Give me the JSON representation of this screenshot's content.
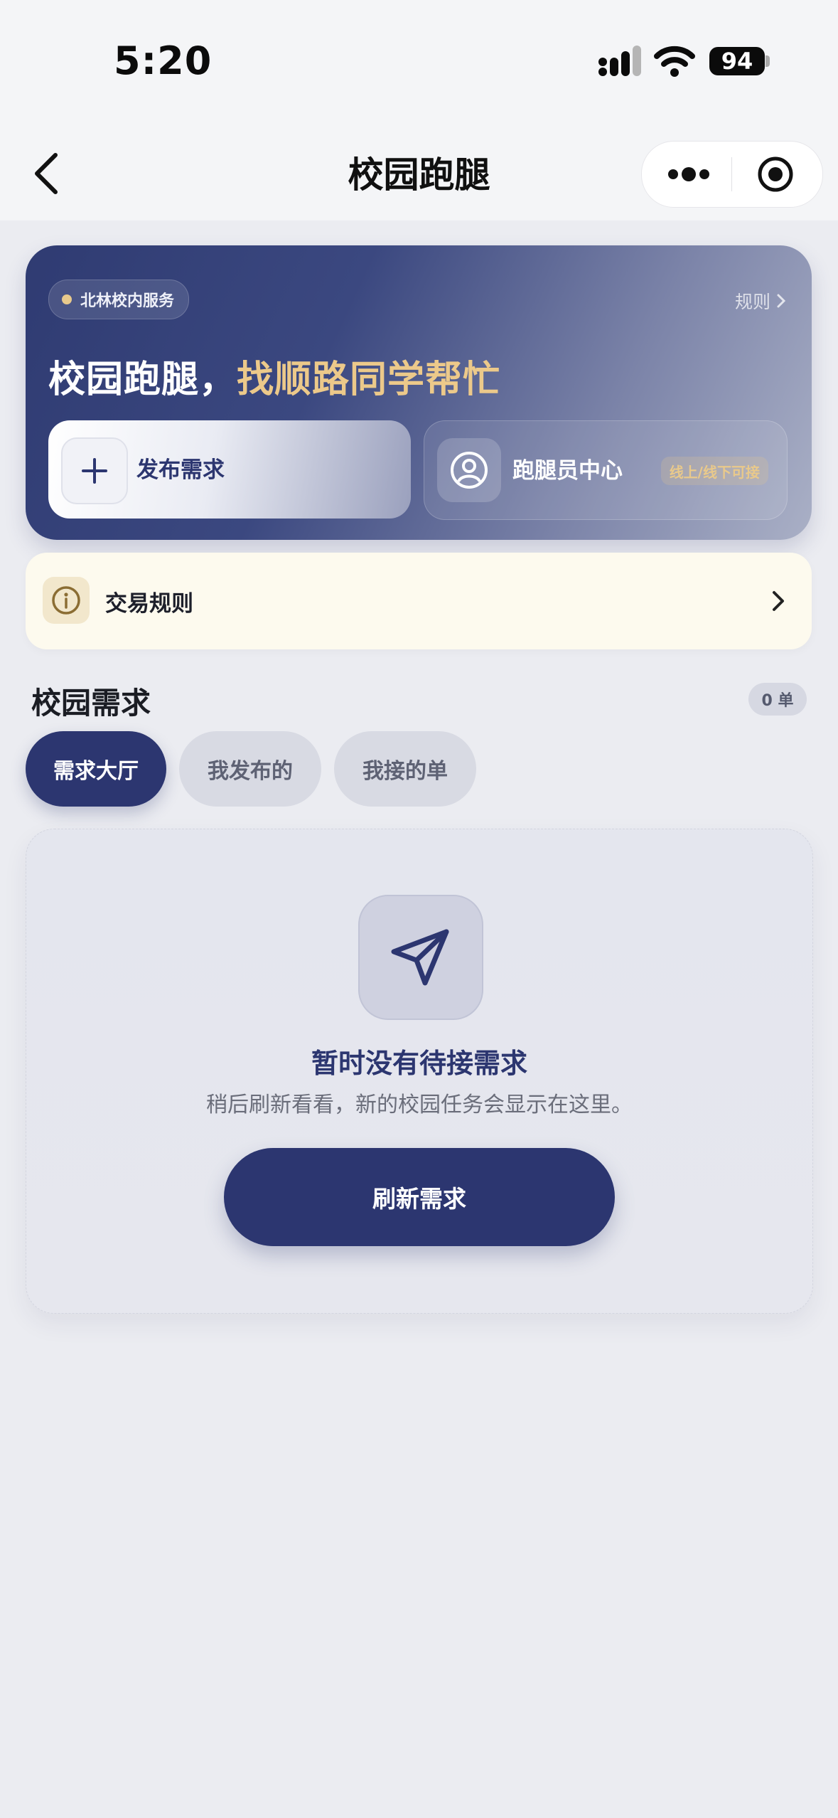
{
  "status_bar": {
    "time": "5:20",
    "battery": "94"
  },
  "nav": {
    "title": "校园跑腿"
  },
  "hero": {
    "badge": "北林校内服务",
    "rules_link": "规则",
    "title_main": "校园跑腿，",
    "title_highlight": "找顺路同学帮忙",
    "post_label": "发布需求",
    "runner_label": "跑腿员中心",
    "runner_tag": "线上/线下可接"
  },
  "rules_bar": {
    "label": "交易规则"
  },
  "section": {
    "title": "校园需求",
    "count": "0 单",
    "tabs": [
      "需求大厅",
      "我发布的",
      "我接的单"
    ]
  },
  "empty_state": {
    "title": "暂时没有待接需求",
    "subtitle": "稍后刷新看看，新的校园任务会显示在这里。",
    "button": "刷新需求"
  },
  "colors": {
    "primary": "#2c3670",
    "gold": "#ecc98a",
    "background": "#ebecf1"
  },
  "icons": [
    "back-arrow-icon",
    "more-dots-icon",
    "record-icon",
    "plus-icon",
    "user-circle-icon",
    "info-icon",
    "chevron-right-icon",
    "paper-plane-icon"
  ]
}
